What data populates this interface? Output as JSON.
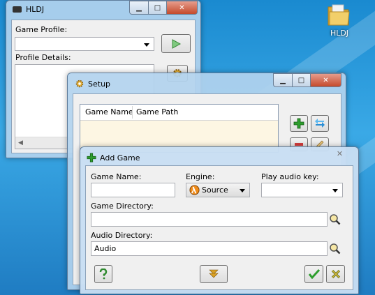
{
  "desktop": {
    "folder_label": "HLDJ",
    "folder_color": "#e8c35a"
  },
  "hldj_window": {
    "title": "HLDJ",
    "game_profile_label": "Game Profile:",
    "game_profile_value": "",
    "profile_details_label": "Profile Details:"
  },
  "setup_window": {
    "title": "Setup",
    "columns": [
      "Game Name",
      "Game Path"
    ]
  },
  "add_game_window": {
    "title": "Add Game",
    "game_name_label": "Game Name:",
    "game_name_value": "",
    "engine_label": "Engine:",
    "engine_value": "Source",
    "play_audio_key_label": "Play audio key:",
    "play_audio_key_value": "",
    "game_directory_label": "Game Directory:",
    "game_directory_value": "",
    "audio_directory_label": "Audio Directory:",
    "audio_directory_value": "Audio"
  },
  "colors": {
    "accent_green": "#2e9e2e",
    "close_red": "#c44a2c",
    "listview_bg": "#fdf6e3"
  }
}
